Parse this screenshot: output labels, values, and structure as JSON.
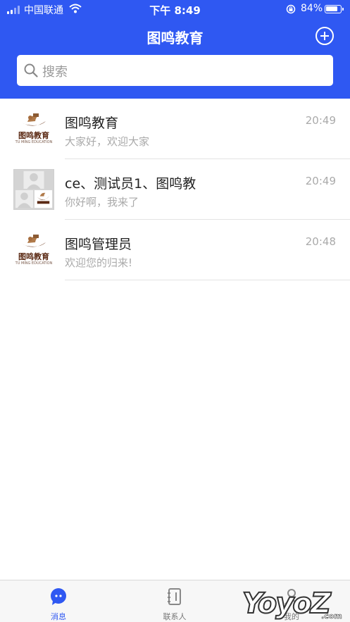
{
  "status_bar": {
    "carrier": "中国联通",
    "time": "下午 8:49",
    "battery_percent": "84%",
    "battery_level": 0.84
  },
  "header": {
    "title": "图鸣教育",
    "add_icon": "plus-circle-icon"
  },
  "search": {
    "placeholder": "搜索",
    "icon": "search-icon"
  },
  "conversations": [
    {
      "name": "图鸣教育",
      "time": "20:49",
      "message": "大家好，欢迎大家",
      "avatar": "logo"
    },
    {
      "name": "ce、测试员1、图鸣教",
      "time": "20:49",
      "message": "你好啊，我来了",
      "avatar": "group"
    },
    {
      "name": "图鸣管理员",
      "time": "20:48",
      "message": "欢迎您的归来!",
      "avatar": "logo"
    }
  ],
  "logo": {
    "text": "图鸣教育",
    "subtext": "TU MING EDUCATION"
  },
  "tabs": [
    {
      "label": "消息",
      "icon": "chat-bubble-icon",
      "active": true
    },
    {
      "label": "联系人",
      "icon": "contacts-book-icon",
      "active": false
    },
    {
      "label": "我的",
      "icon": "person-icon",
      "active": false
    }
  ],
  "watermark": "Yo!yoZ.com",
  "colors": {
    "primary": "#2f58f2",
    "tab_active": "#2f58f2",
    "tab_inactive": "#777777"
  }
}
